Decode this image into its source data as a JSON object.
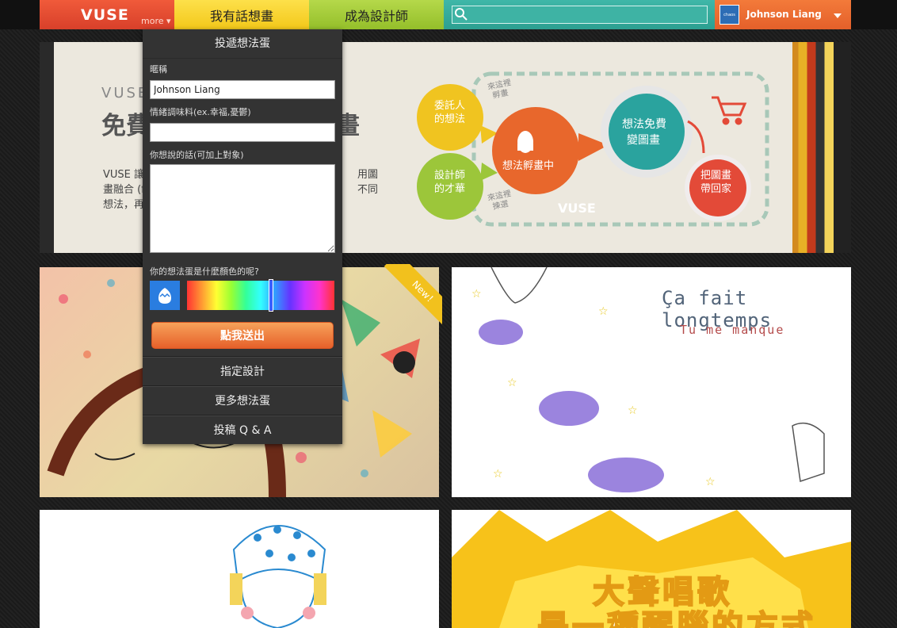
{
  "nav": {
    "logo": "VUSE",
    "more": "more ▾",
    "tab_idea": "我有話想畫",
    "tab_designer": "成為設計師",
    "user_name": "Johnson Liang",
    "avatar_label": "chaos"
  },
  "banner": {
    "brand": "VUSE",
    "title_left": "免費",
    "title_right": "畫",
    "text_left_1": "VUSE 讓各",
    "text_left_2": "畫融合 (fus",
    "text_left_3": "想法，再由",
    "text_right_1": "用圖",
    "text_right_2": "不同",
    "bubble_client": "委託人\n的想法",
    "bubble_designer": "設計師\n的才華",
    "bubble_hatch": "想法孵畫中",
    "bubble_free": "想法免費\n變圖畫",
    "bubble_home": "把圖畫\n帶回家",
    "note_hatch": "來這裡\n孵畫",
    "note_pick": "來這裡\n揀選",
    "watermark": "VUSE"
  },
  "dropdown": {
    "title": "投遞想法蛋",
    "nickname_label": "暱稱",
    "nickname_value": "Johnson Liang",
    "mood_label": "情緒調味料(ex.幸福,憂鬱)",
    "mood_value": "",
    "message_label": "你想說的話(可加上對象)",
    "color_label": "你的想法蛋是什麼顏色的呢?",
    "color_hue_fraction": 0.57,
    "egg_color": "#2a7de0",
    "submit_label": "點我送出",
    "link_assign": "指定設計",
    "link_more": "更多想法蛋",
    "link_qa": "投稿 Q & A"
  },
  "tiles": {
    "new_badge": "New！",
    "french_line1": "Ça fait longtemps",
    "french_line2": "Tu me manque",
    "sing_line1": "大聲唱歌",
    "sing_line2": "是一種醒腦的方式"
  },
  "colors": {
    "logo_bg": "#e84c30",
    "tab_yellow": "#f7d02a",
    "tab_green": "#a4cc3a",
    "search_bg": "#35ab9c",
    "user_bg": "#ec6b32",
    "submit_orange": "#ef7a3a"
  }
}
